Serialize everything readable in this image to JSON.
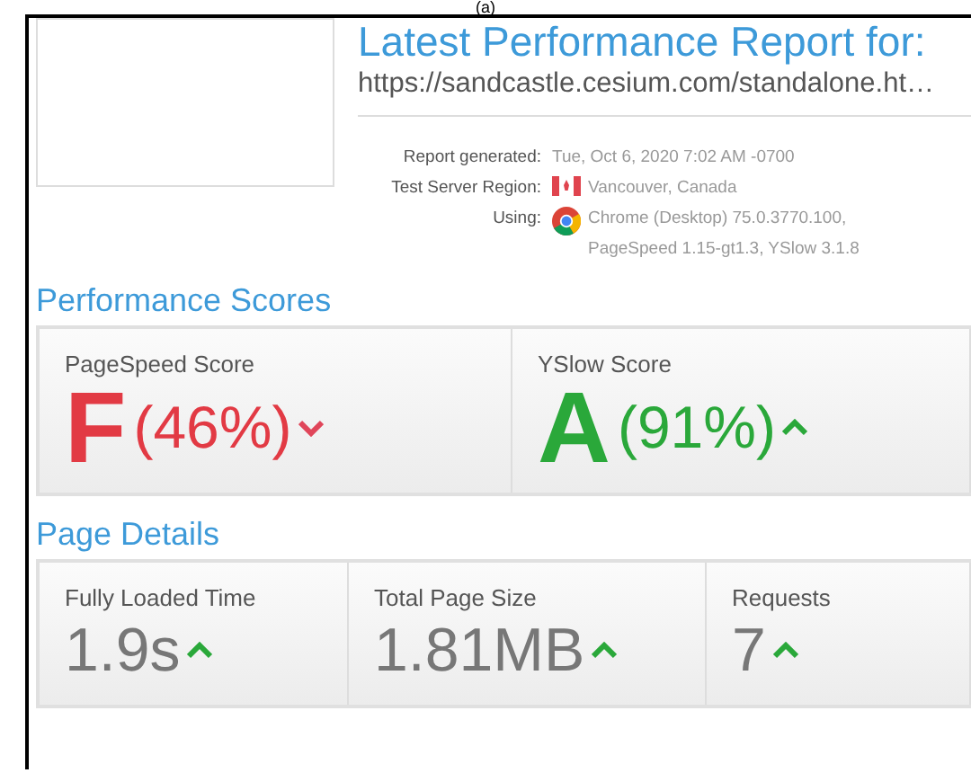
{
  "caption": "(a)",
  "report": {
    "title": "Latest Performance Report for:",
    "url": "https://sandcastle.cesium.com/standalone.ht…",
    "meta": [
      {
        "label": "Report generated:",
        "kind": "text",
        "lines": [
          "Tue, Oct 6, 2020 7:02 AM -0700"
        ]
      },
      {
        "label": "Test Server Region:",
        "kind": "flag",
        "lines": [
          "Vancouver, Canada"
        ]
      },
      {
        "label": "Using:",
        "kind": "browser",
        "lines": [
          "Chrome (Desktop) 75.0.3770.100,",
          "PageSpeed 1.15-gt1.3, YSlow 3.1.8"
        ]
      }
    ]
  },
  "scores": {
    "heading": "Performance Scores",
    "items": [
      {
        "label": "PageSpeed Score",
        "grade": "F",
        "percent": "(46%)",
        "kind": "bad"
      },
      {
        "label": "YSlow Score",
        "grade": "A",
        "percent": "(91%)",
        "kind": "good"
      }
    ]
  },
  "details": {
    "heading": "Page Details",
    "items": [
      {
        "label": "Fully Loaded Time",
        "value": "1.9s"
      },
      {
        "label": "Total Page Size",
        "value": "1.81MB"
      },
      {
        "label": "Requests",
        "value": "7"
      }
    ]
  }
}
